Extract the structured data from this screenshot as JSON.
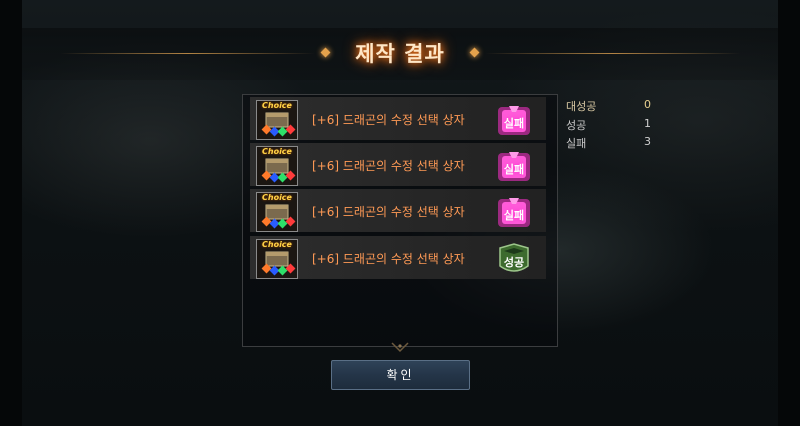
{
  "dialog": {
    "title": "제작 결과"
  },
  "results": [
    {
      "item": "[+6] 드래곤의 수정 선택 상자",
      "icon_label": "Choice",
      "result": "실패",
      "status": "fail"
    },
    {
      "item": "[+6] 드래곤의 수정 선택 상자",
      "icon_label": "Choice",
      "result": "실패",
      "status": "fail"
    },
    {
      "item": "[+6] 드래곤의 수정 선택 상자",
      "icon_label": "Choice",
      "result": "실패",
      "status": "fail"
    },
    {
      "item": "[+6] 드래곤의 수정 선택 상자",
      "icon_label": "Choice",
      "result": "성공",
      "status": "success"
    }
  ],
  "stats": [
    {
      "label": "대성공",
      "value": "0"
    },
    {
      "label": "성공",
      "value": "1"
    },
    {
      "label": "실패",
      "value": "3"
    }
  ],
  "buttons": {
    "confirm": "확인"
  },
  "colors": {
    "fail": "#ff3fd2",
    "success": "#4d8a3a",
    "item_text": "#ff9a55",
    "title_glow": "#ff7a1a"
  },
  "icons": {
    "item": "crystal-choice-box-icon",
    "fail": "fail-stamp-icon",
    "success": "success-shield-icon"
  }
}
